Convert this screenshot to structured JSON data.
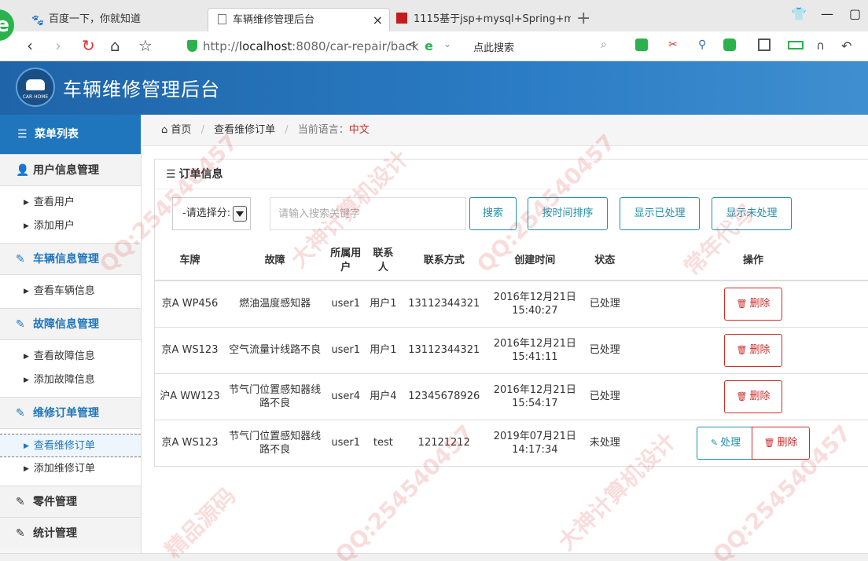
{
  "browser": {
    "tabs": [
      {
        "title": "百度一下，你就知道"
      },
      {
        "title": "车辆维修管理后台",
        "active": true
      },
      {
        "title": "1115基于jsp+mysql+Spring+m"
      }
    ],
    "url_prefix": "http://",
    "url_host": "localhost",
    "url_rest": ":8080/car-repair/back",
    "search_hint": "点此搜索",
    "logo_glyph": "e"
  },
  "header": {
    "title": "车辆维修管理后台",
    "logo_text": "CAR HOME"
  },
  "sidebar": {
    "menu_title": "菜单列表",
    "groups": [
      {
        "label": "用户信息管理",
        "items": [
          "查看用户",
          "添加用户"
        ]
      },
      {
        "label": "车辆信息管理",
        "items": [
          "查看车辆信息"
        ]
      },
      {
        "label": "故障信息管理",
        "items": [
          "查看故障信息",
          "添加故障信息"
        ]
      },
      {
        "label": "维修订单管理",
        "items": [
          "查看维修订单",
          "添加维修订单"
        ]
      },
      {
        "label": "零件管理",
        "items": []
      },
      {
        "label": "统计管理",
        "items": []
      }
    ]
  },
  "breadcrumb": {
    "home": "首页",
    "current": "查看维修订单",
    "lang_label": "当前语言：",
    "lang_value": "中文"
  },
  "panel": {
    "title": "订单信息",
    "select_value": "-请选择分:",
    "search_placeholder": "请输入搜索关键字",
    "buttons": {
      "search": "搜索",
      "sort_time": "按时间排序",
      "show_done": "显示已处理",
      "show_pending": "显示未处理"
    }
  },
  "table": {
    "columns": [
      "车牌",
      "故障",
      "所属用户",
      "联系人",
      "联系方式",
      "创建时间",
      "状态",
      "操作"
    ],
    "rows": [
      {
        "plate": "京A WP456",
        "fault": "燃油温度感知器",
        "user": "user1",
        "contact": "用户1",
        "phone": "13112344321",
        "created": "2016年12月21日 15:40:27",
        "status": "已处理",
        "done": true
      },
      {
        "plate": "京A WS123",
        "fault": "空气流量计线路不良",
        "user": "user1",
        "contact": "用户1",
        "phone": "13112344321",
        "created": "2016年12月21日 15:41:11",
        "status": "已处理",
        "done": true
      },
      {
        "plate": "沪A WW123",
        "fault": "节气门位置感知器线路不良",
        "user": "user4",
        "contact": "用户4",
        "phone": "12345678926",
        "created": "2016年12月21日 15:54:17",
        "status": "已处理",
        "done": true
      },
      {
        "plate": "京A WS123",
        "fault": "节气门位置感知器线路不良",
        "user": "user1",
        "contact": "test",
        "phone": "12121212",
        "created": "2019年07月21日 14:17:34",
        "status": "未处理",
        "done": false
      }
    ],
    "delete_label": "删除",
    "process_label": "处理"
  },
  "watermark": [
    "常年代写",
    "QQ:254540457",
    "大神计算机设计",
    "精品源码"
  ],
  "colors": {
    "header_blue": "#1f64a8",
    "menu_blue": "#1f76bd",
    "teal": "#1f8fa8",
    "danger": "#c9302c",
    "success": "#19a979"
  }
}
